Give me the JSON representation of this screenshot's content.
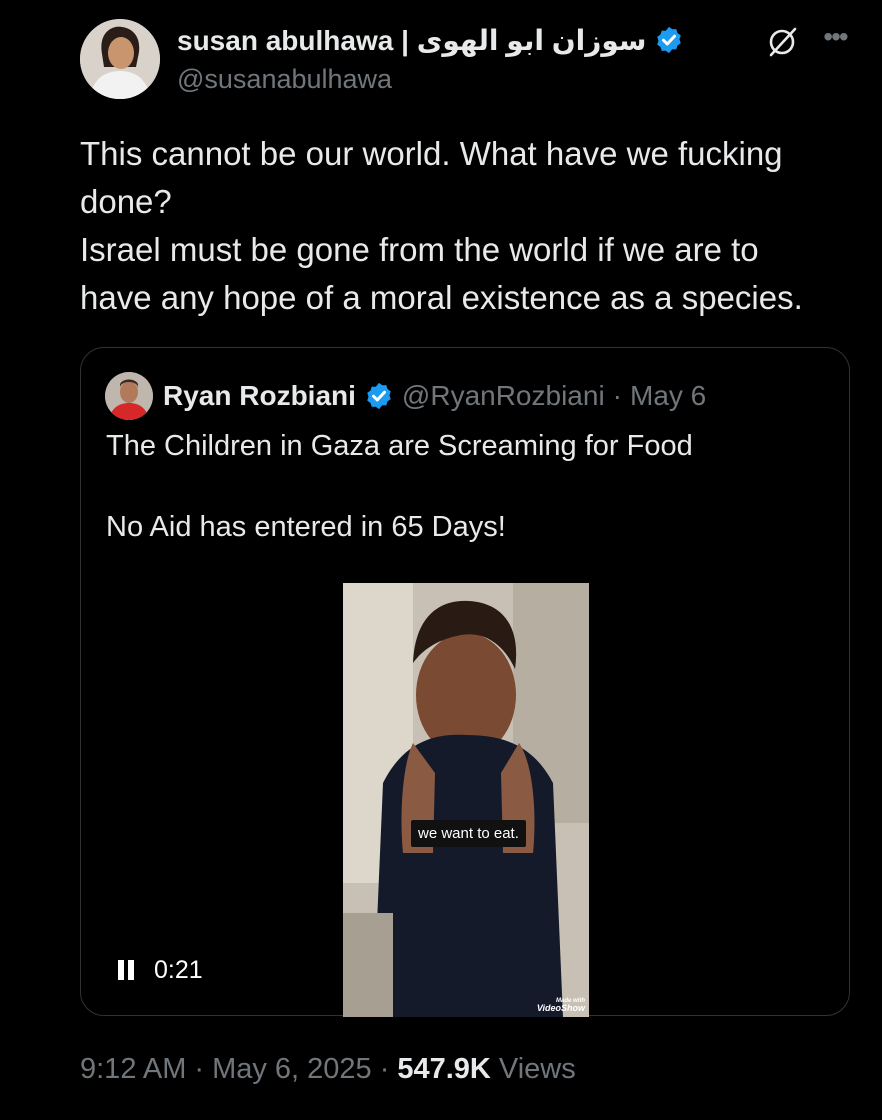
{
  "author": {
    "name": "susan abulhawa | سوزان ابو الهوى",
    "handle": "@susanabulhawa"
  },
  "tweet": {
    "lines": [
      "This cannot be our world.  What have we fucking",
      "done?",
      "Israel must be gone from the world if we are to",
      "have any hope of a moral existence as a species."
    ]
  },
  "quote": {
    "name": "Ryan Rozbiani",
    "handle": "@RyanRozbiani",
    "separator": "·",
    "date": "May 6",
    "line1": "The Children in Gaza are Screaming for Food",
    "line2": "No Aid has entered in 65 Days!",
    "video": {
      "caption": "we want to eat.",
      "duration": "0:21",
      "watermark_small": "Made with",
      "watermark_big": "VideoShow"
    }
  },
  "meta": {
    "time": "9:12 AM",
    "sep1": "·",
    "date": "May 6, 2025",
    "sep2": "·",
    "views_count": "547.9K",
    "views_label": "Views"
  },
  "icons": {
    "verified": "verified-badge-icon",
    "grok": "grok-icon",
    "more": "more-options-icon",
    "pause": "pause-icon"
  },
  "colors": {
    "background": "#000000",
    "text": "#e7e9ea",
    "secondary": "#71767b",
    "verified": "#1d9bf0",
    "border": "#2f3336"
  }
}
